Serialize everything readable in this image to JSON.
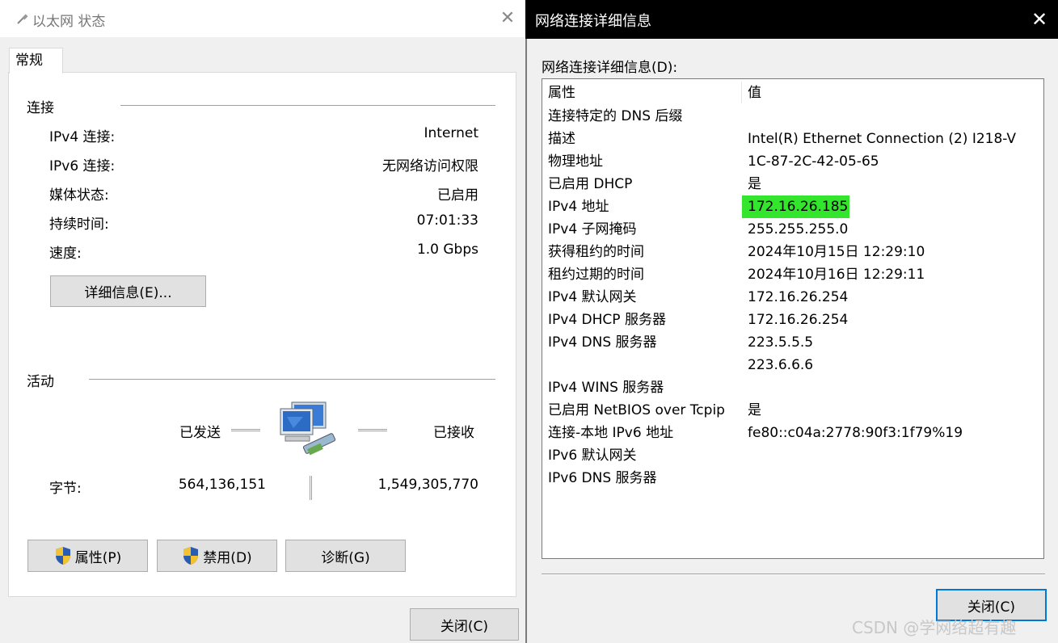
{
  "left_dialog": {
    "title": "以太网 状态",
    "tab": "常规",
    "connection_group": "连接",
    "rows": [
      {
        "label": "IPv4 连接:",
        "value": "Internet"
      },
      {
        "label": "IPv6 连接:",
        "value": "无网络访问权限"
      },
      {
        "label": "媒体状态:",
        "value": "已启用"
      },
      {
        "label": "持续时间:",
        "value": "07:01:33"
      },
      {
        "label": "速度:",
        "value": "1.0 Gbps"
      }
    ],
    "details_button": "详细信息(E)...",
    "activity_group": "活动",
    "sent_label": "已发送",
    "received_label": "已接收",
    "bytes_label": "字节:",
    "bytes_sent": "564,136,151",
    "bytes_received": "1,549,305,770",
    "properties_button": "属性(P)",
    "disable_button": "禁用(D)",
    "diagnose_button": "诊断(G)",
    "close_button": "关闭(C)"
  },
  "right_dialog": {
    "title": "网络连接详细信息",
    "list_label": "网络连接详细信息(D):",
    "col_property": "属性",
    "col_value": "值",
    "rows": [
      {
        "property": "连接特定的 DNS 后缀",
        "value": ""
      },
      {
        "property": "描述",
        "value": "Intel(R) Ethernet Connection (2) I218-V"
      },
      {
        "property": "物理地址",
        "value": "1C-87-2C-42-05-65"
      },
      {
        "property": "已启用 DHCP",
        "value": "是"
      },
      {
        "property": "IPv4 地址",
        "value": "172.16.26.185",
        "highlighted": true
      },
      {
        "property": "IPv4 子网掩码",
        "value": "255.255.255.0"
      },
      {
        "property": "获得租约的时间",
        "value": "2024年10月15日 12:29:10"
      },
      {
        "property": "租约过期的时间",
        "value": "2024年10月16日 12:29:11"
      },
      {
        "property": "IPv4 默认网关",
        "value": "172.16.26.254"
      },
      {
        "property": "IPv4 DHCP 服务器",
        "value": "172.16.26.254"
      },
      {
        "property": "IPv4 DNS 服务器",
        "value": "223.5.5.5"
      },
      {
        "property": "",
        "value": "223.6.6.6"
      },
      {
        "property": "IPv4 WINS 服务器",
        "value": ""
      },
      {
        "property": "已启用 NetBIOS over Tcpip",
        "value": "是"
      },
      {
        "property": "连接-本地 IPv6 地址",
        "value": "fe80::c04a:2778:90f3:1f79%19"
      },
      {
        "property": "IPv6 默认网关",
        "value": ""
      },
      {
        "property": "IPv6 DNS 服务器",
        "value": ""
      }
    ],
    "close_button": "关闭(C)"
  },
  "watermark": "CSDN @学网络超有趣",
  "colors": {
    "highlight": "#33e52d",
    "dialog_bg": "#f0f0f0",
    "right_titlebar": "#000000",
    "focus_border": "#0078d7"
  }
}
